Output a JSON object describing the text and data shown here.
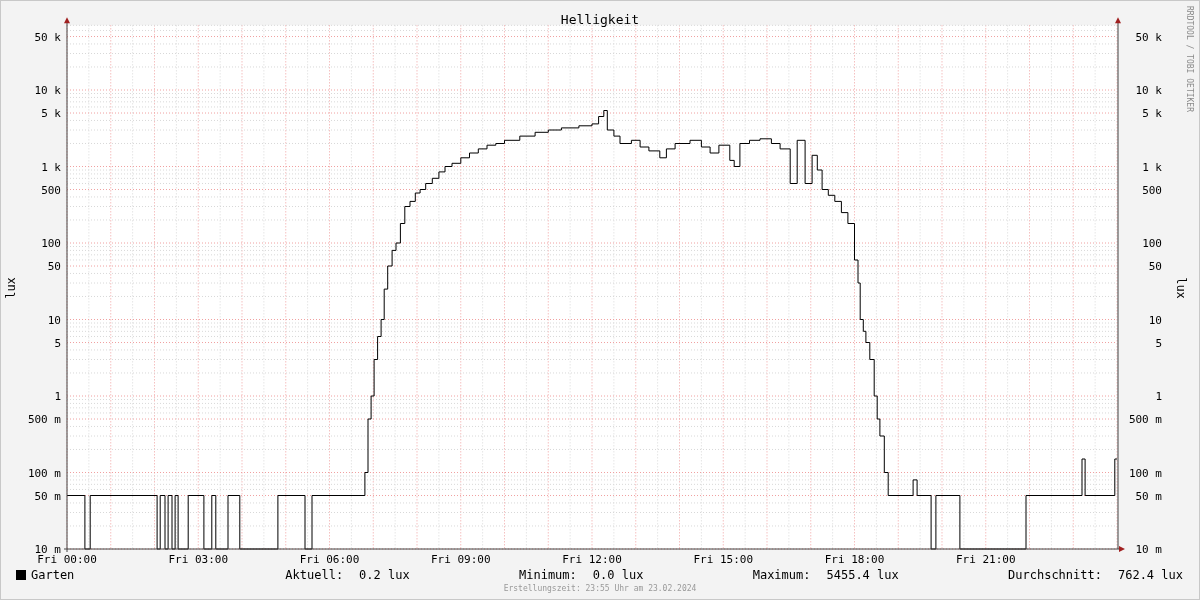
{
  "title": "Helligkeit",
  "credit": "RRDTOOL / TOBI OETIKER",
  "y_axis_label_left": "lux",
  "y_axis_label_right": "lux",
  "left_tick_labels": [
    "50 k",
    "10 k",
    "5 k",
    "1 k",
    "500",
    "100",
    "50",
    "10",
    "5",
    "1",
    "500 m",
    "100 m",
    "50 m",
    "10 m"
  ],
  "right_tick_labels": [
    "50 k",
    "10 k",
    "5 k",
    "1 k",
    "500",
    "100",
    "50",
    "10",
    "5",
    "1",
    "500 m",
    "100 m",
    "50 m",
    "10 m"
  ],
  "x_tick_labels": [
    "Fri 00:00",
    "Fri 03:00",
    "Fri 06:00",
    "Fri 09:00",
    "Fri 12:00",
    "Fri 15:00",
    "Fri 18:00",
    "Fri 21:00"
  ],
  "legend": {
    "name": "Garten",
    "color": "#000000"
  },
  "stats": [
    {
      "label": "Aktuell:",
      "value": "0.2 lux"
    },
    {
      "label": "Minimum:",
      "value": "0.0 lux"
    },
    {
      "label": "Maximum:",
      "value": "5455.4 lux"
    },
    {
      "label": "Durchschnitt:",
      "value": "762.4 lux"
    }
  ],
  "timestamp": "Erstellungszeit: 23:55 Uhr am 23.02.2024"
}
